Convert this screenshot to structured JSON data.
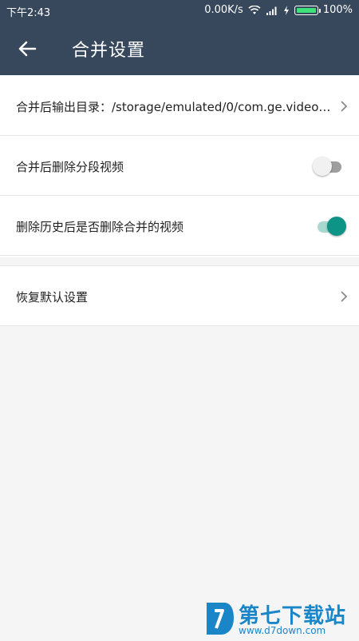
{
  "status_bar": {
    "time": "下午2:43",
    "network_speed": "0.00K/s",
    "battery": "100%",
    "icons": [
      "wifi-icon",
      "signal-icon",
      "charging-icon",
      "battery-icon"
    ]
  },
  "app_bar": {
    "back_icon": "back-arrow-icon",
    "title": "合并设置"
  },
  "settings": {
    "output_dir_label": "合并后输出目录：/storage/emulated/0/com.ge.video…",
    "delete_segments_label": "合并后删除分段视频",
    "delete_segments_enabled": false,
    "delete_merged_label": "删除历史后是否删除合并的视频",
    "delete_merged_enabled": true,
    "restore_defaults_label": "恢复默认设置"
  },
  "watermark": {
    "title": "第七下载站",
    "url": "www.d7down.com"
  },
  "colors": {
    "app_bar": "#37475c",
    "toggle_on": "#0e9486",
    "toggle_on_track": "#a8d8d0",
    "watermark": "#1b86c7"
  }
}
